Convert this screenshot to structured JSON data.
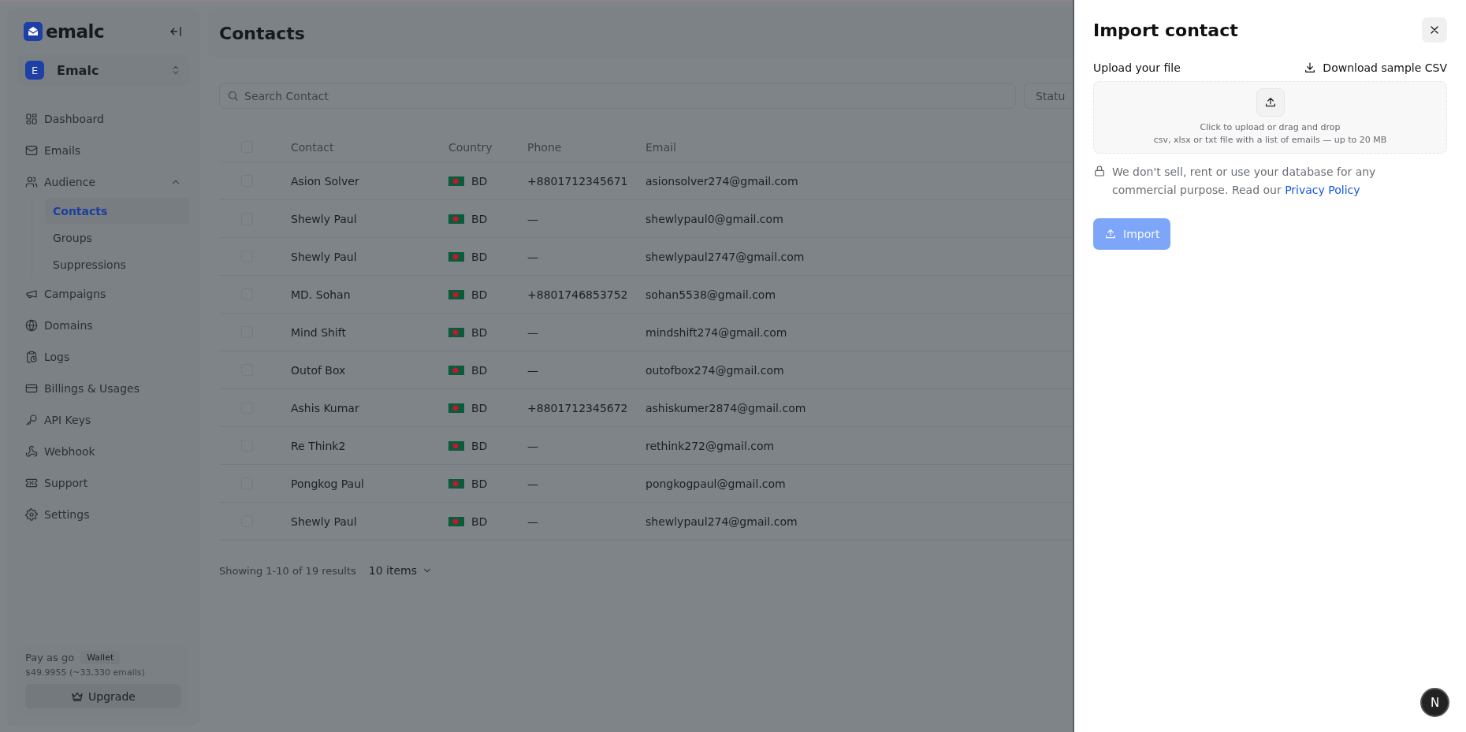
{
  "sidebar": {
    "logo": "emalc",
    "workspace": {
      "initial": "E",
      "name": "Emalc"
    },
    "items": [
      {
        "kind": "item",
        "label": "Dashboard",
        "selected": false
      },
      {
        "kind": "item",
        "label": "Emails",
        "selected": false
      },
      {
        "kind": "group",
        "label": "Audience",
        "expanded": true,
        "children": [
          {
            "label": "Contacts",
            "selected": true
          },
          {
            "label": "Groups",
            "selected": false
          },
          {
            "label": "Suppressions",
            "selected": false
          }
        ]
      },
      {
        "kind": "item",
        "label": "Campaigns",
        "selected": false
      },
      {
        "kind": "item",
        "label": "Domains",
        "selected": false
      },
      {
        "kind": "item",
        "label": "Logs",
        "selected": false
      },
      {
        "kind": "item",
        "label": "Billings & Usages",
        "selected": false
      },
      {
        "kind": "item",
        "label": "API Keys",
        "selected": false
      },
      {
        "kind": "item",
        "label": "Webhook",
        "selected": false
      },
      {
        "kind": "item",
        "label": "Support",
        "selected": false
      },
      {
        "kind": "item",
        "label": "Settings",
        "selected": false
      }
    ],
    "plan": {
      "name": "Pay as go",
      "badge": "Wallet",
      "balance": "$49.9955 (~33,330 emails)",
      "button": "Upgrade"
    }
  },
  "page": {
    "title": "Contacts",
    "search": {
      "placeholder": "Search Contact"
    },
    "filter": "Statu",
    "table": {
      "select_all_checked": false,
      "columns": [
        "Contact",
        "Country",
        "Phone",
        "Email"
      ],
      "rows": [
        {
          "checked": false,
          "cells": [
            "Asion Solver",
            "BD",
            "+8801712345671",
            "asionsolver274@gmail.com"
          ]
        },
        {
          "checked": false,
          "cells": [
            "Shewly Paul",
            "BD",
            "—",
            "shewlypaul0@gmail.com"
          ]
        },
        {
          "checked": false,
          "cells": [
            "Shewly Paul",
            "BD",
            "—",
            "shewlypaul2747@gmail.com"
          ]
        },
        {
          "checked": false,
          "cells": [
            "MD. Sohan",
            "BD",
            "+8801746853752",
            "sohan5538@gmail.com"
          ]
        },
        {
          "checked": false,
          "cells": [
            "Mind Shift",
            "BD",
            "—",
            "mindshift274@gmail.com"
          ]
        },
        {
          "checked": false,
          "cells": [
            "Outof Box",
            "BD",
            "—",
            "outofbox274@gmail.com"
          ]
        },
        {
          "checked": false,
          "cells": [
            "Ashis Kumar",
            "BD",
            "+8801712345672",
            "ashiskumer2874@gmail.com"
          ]
        },
        {
          "checked": false,
          "cells": [
            "Re Think2",
            "BD",
            "—",
            "rethink272@gmail.com"
          ]
        },
        {
          "checked": false,
          "cells": [
            "Pongkog Paul",
            "BD",
            "—",
            "pongkogpaul@gmail.com"
          ]
        },
        {
          "checked": false,
          "cells": [
            "Shewly Paul",
            "BD",
            "—",
            "shewlypaul274@gmail.com"
          ]
        }
      ]
    },
    "pagination": {
      "summary": "Showing 1-10 of 19 results",
      "page_size": "10 items"
    }
  },
  "drawer": {
    "title": "Import contact",
    "upload_label": "Upload your file",
    "download_link": "Download sample CSV",
    "dropzone": {
      "line1": "Click to upload or drag and drop",
      "line2": "csv, xlsx or txt file with a list of emails — up to 20 MB"
    },
    "privacy_text": "We don't sell, rent or use your database for any commercial purpose. Read our ",
    "privacy_link": "Privacy Policy",
    "import_button": {
      "label": "Import",
      "disabled": true
    }
  },
  "avatar_badge": "N"
}
